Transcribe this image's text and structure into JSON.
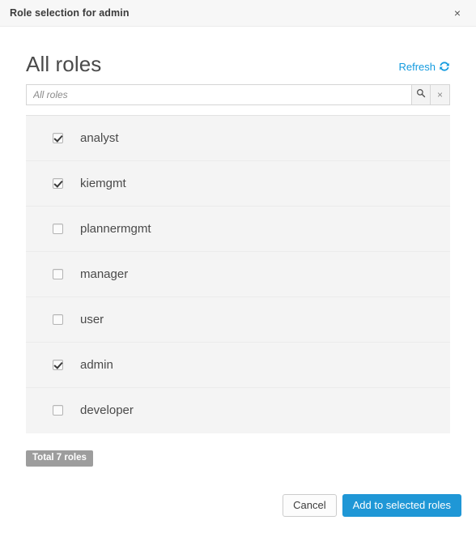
{
  "window": {
    "title": "Role selection for admin",
    "close_icon": "close-icon",
    "close_label": "×"
  },
  "panel": {
    "title": "All roles",
    "refresh_label": "Refresh",
    "refresh_icon": "sync-refresh-icon"
  },
  "search": {
    "value": "",
    "placeholder": "All roles",
    "search_icon": "magnifier-icon",
    "clear_icon": "clear-x-icon",
    "clear_label": "×"
  },
  "roles": [
    {
      "name": "analyst",
      "checked": true
    },
    {
      "name": "kiemgmt",
      "checked": true
    },
    {
      "name": "plannermgmt",
      "checked": false
    },
    {
      "name": "manager",
      "checked": false
    },
    {
      "name": "user",
      "checked": false
    },
    {
      "name": "admin",
      "checked": true
    },
    {
      "name": "developer",
      "checked": false
    }
  ],
  "total": {
    "label": "Total 7 roles",
    "count": 7
  },
  "footer": {
    "cancel_label": "Cancel",
    "submit_label": "Add to selected roles"
  },
  "colors": {
    "accent": "#1f97d6",
    "link": "#149bdf",
    "badge": "#9d9d9d",
    "header_bg": "#f7f7f7",
    "list_bg": "#f4f4f4"
  }
}
